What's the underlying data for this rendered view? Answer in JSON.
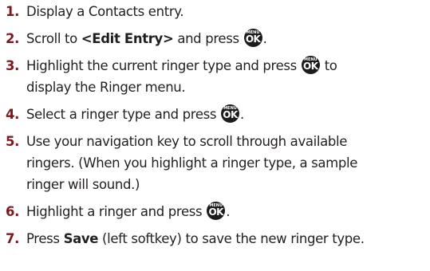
{
  "key_icon": {
    "menu": "MENU",
    "ok": "OK"
  },
  "steps": [
    {
      "num": "1.",
      "text": "Display a Contacts entry."
    },
    {
      "num": "2.",
      "pre": "Scroll to ",
      "bold": "<Edit Entry>",
      "post": " and press ",
      "end": "."
    },
    {
      "num": "3.",
      "line1_pre": "Highlight the current ringer type and press ",
      "line1_post": " to",
      "line2": "display the Ringer menu."
    },
    {
      "num": "4.",
      "pre": "Select a ringer type and press ",
      "end": "."
    },
    {
      "num": "5.",
      "line1": "Use your navigation key to scroll through available",
      "line2": "ringers. (When you highlight a ringer type, a sample",
      "line3": "ringer will sound.)"
    },
    {
      "num": "6.",
      "pre": "Highlight a ringer and press ",
      "end": "."
    },
    {
      "num": "7.",
      "pre": "Press ",
      "bold": "Save",
      "post": " (left softkey) to save the new ringer type."
    }
  ]
}
